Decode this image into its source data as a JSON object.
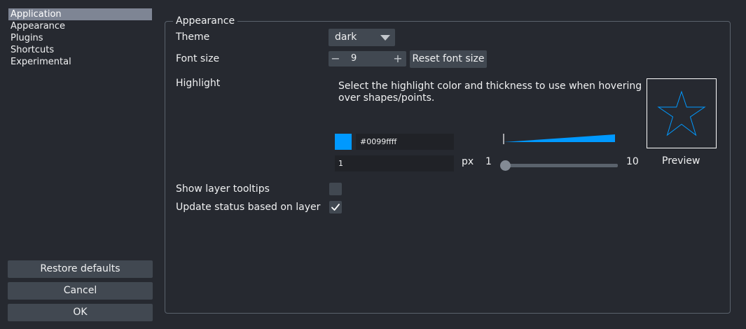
{
  "sidebar": {
    "items": [
      {
        "label": "Application",
        "active": true
      },
      {
        "label": "Appearance",
        "active": false
      },
      {
        "label": "Plugins",
        "active": false
      },
      {
        "label": "Shortcuts",
        "active": false
      },
      {
        "label": "Experimental",
        "active": false
      }
    ],
    "restore_label": "Restore defaults",
    "cancel_label": "Cancel",
    "ok_label": "OK"
  },
  "appearance": {
    "group_title": "Appearance",
    "theme_label": "Theme",
    "theme_value": "dark",
    "font_size_label": "Font size",
    "font_size_value": "9",
    "font_minus": "−",
    "font_plus": "+",
    "reset_font_label": "Reset font size",
    "highlight_label": "Highlight",
    "highlight_description": "Select the highlight color and thickness to use when hovering over shapes/points.",
    "color_hex": "#0099ffff",
    "color": "#0099ff",
    "thickness_value": "1",
    "px_label": "px",
    "slider_min": "1",
    "slider_max": "10",
    "slider_value": 1,
    "preview_label": "Preview",
    "layer_tooltips_label": "Show layer tooltips",
    "layer_tooltips_checked": false,
    "update_status_label": "Update status based on layer",
    "update_status_checked": true
  }
}
